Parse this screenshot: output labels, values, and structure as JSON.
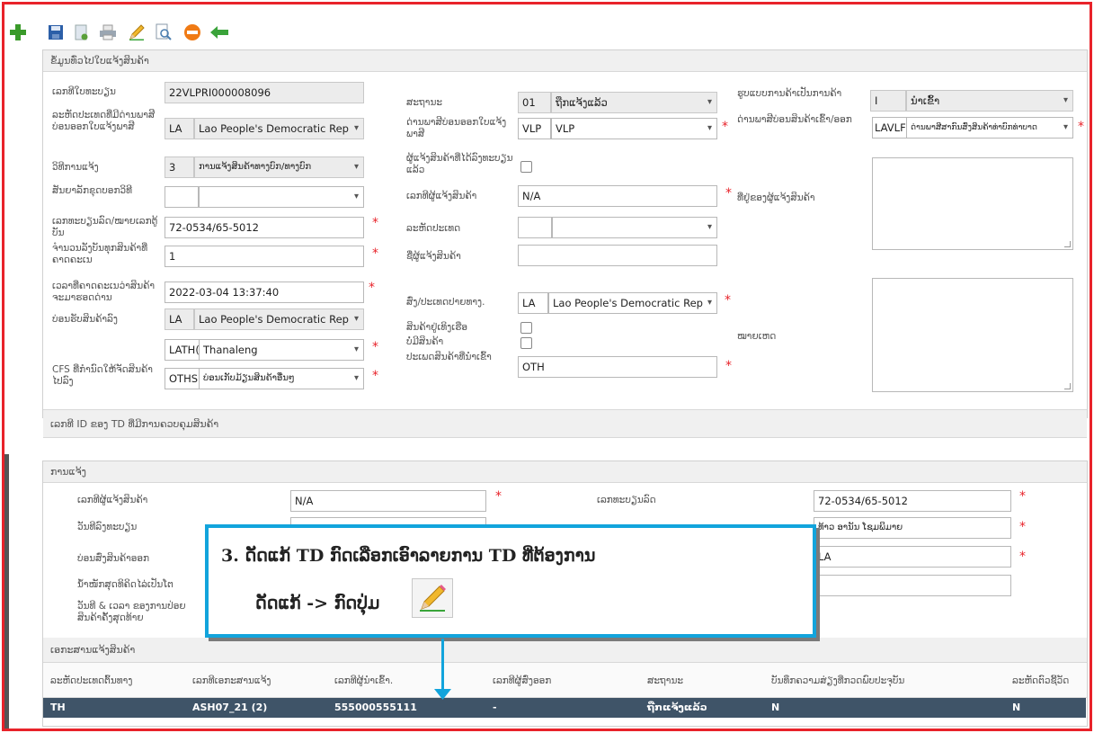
{
  "toolbar": {
    "icons": [
      "plus-icon",
      "save-icon",
      "new-doc-icon",
      "print-icon",
      "pencil-icon",
      "preview-icon",
      "delete-icon",
      "back-arrow-icon"
    ]
  },
  "section1": {
    "title": "ຂໍ້ມູນທົ່ວໄປໃບແຈ້ງສິນຄ້າ",
    "registration_number": {
      "label": "ເລກທີໃບທະບຽນ",
      "value": "22VLPRI000008096"
    },
    "country_code": {
      "label": "ລະຫັດປະເທດທີ່ມີດ່ານພາສີບ່ອນອອກໃບແຈ້ງພາສີ",
      "code": "LA",
      "name": "Lao People's Democratic Rep"
    },
    "transport_method": {
      "label": "ວິທີການແຈ້ງ",
      "code": "3",
      "name": "ການແຈ້ງສິນຄ້າທາງບົກ/ທາງບົກ"
    },
    "transport_detail": {
      "label": "ສັນຍາລັກຂຸດບອກວິທີ",
      "code": "",
      "name": ""
    },
    "vehicle_plate": {
      "label": "ເລກທະບຽນລົດ/ໝາຍເລກຕູ້ບັນ",
      "value": "72-0534/65-5012"
    },
    "packages_count": {
      "label": "ຈຳນວນລັງບັນທຸກສິນຄ້າທີ່ຄາດຄະເນ",
      "value": "1"
    },
    "arrival_datetime": {
      "label": "ເວລາທີ່ຄາດຄະເນວ່າສິນຄ້າຈະມາຮອດດ່ານ",
      "value": "2022-03-04 13:37:40"
    },
    "receive_country": {
      "label": "ບ່ອນຮັບສິນຄ້າລົງ",
      "code": "LA",
      "name": "Lao People's Democratic Rep"
    },
    "receive_office": {
      "code": "LATH(",
      "name": "Thanaleng"
    },
    "cfs_place": {
      "label": "CFS ທີ່ກຳນົດໃຫ້ຈັດສິນຄ້າໄປລົງ",
      "code": "OTHS",
      "name": "ບ່ອນເກັບມ້ຽນສິນຄ້າອື່ນໆ"
    },
    "status": {
      "label": "ສະຖານະ",
      "code": "01",
      "name": "ຖືກແຈ້ງແລ້ວ"
    },
    "customs_office": {
      "label": "ດ່ານພາສີບ່ອນອອກໃບແຈ້ງພາສີ",
      "code": "VLP",
      "name": "VLP"
    },
    "declarant_registered": {
      "label": "ຜູ້ແຈ້ງສິນຄ້າທີ່ໄດ້ລົງທະບຽນແລ້ວ"
    },
    "declarant_number": {
      "label": "ເລກທີຜູ້ແຈ້ງສິນຄ້າ",
      "value": "N/A"
    },
    "country_code2": {
      "label": "ລະຫັດປະເທດ",
      "code": "",
      "name": ""
    },
    "declarant_name": {
      "label": "ຊື່ຜູ້ແຈ້ງສິນຄ້າ",
      "value": ""
    },
    "destination_country": {
      "label": "ສົ່ງ/ປະເທດປາຍທາງ.",
      "code": "LA",
      "name": "Lao People's Democratic Rep"
    },
    "dangerous_goods": {
      "label": "ສິນຄ້າຢູ່ເທິງເຮືອ"
    },
    "no_goods": {
      "label": "ບໍ່ມີສິນຄ້າ"
    },
    "goods_type": {
      "label": "ປະເພດສິນຄ້າທີ່ນຳເຂົ້າ",
      "value": "OTH"
    },
    "goods_category": {
      "label": "ຮູບແບບການຄ້າເປັນການຄ້າ",
      "code": "I",
      "name": "ນຳເຂົ້າ"
    },
    "border_office": {
      "label": "ດ່ານພາສີບ່ອນສິນຄ້າເຂົ້າ/ອອກ",
      "code": "LAVLF",
      "name": "ດ່ານພາສີສາກົນສົ່ງສິນຄ້າທ່າບົກທ່າບາດ"
    },
    "declarant_address": {
      "label": "ທີ່ຢູ່ຂອງຜູ້ແຈ້ງສິນຄ້າ"
    },
    "remarks": {
      "label": "ໝາຍເຫດ"
    }
  },
  "section2": {
    "title": "ເລກທີ ID ຂອງ TD ທີ່ມີການຄວບຄຸມສິນຄ້າ"
  },
  "section3": {
    "title": "ການແຈ້ງ",
    "declarant_number": {
      "label": "ເລກທີຜູ້ແຈ້ງສິນຄ້າ",
      "value": "N/A"
    },
    "registration_date": {
      "label": "ວັນທີລົງທະບຽນ",
      "value": ""
    },
    "exit_place": {
      "label": "ບ່ອນສົ່ງສິນຄ້າອອກ",
      "value": ""
    },
    "cargo_weight": {
      "label": "ນ້ຳໜັກສຸດທິຄິດໄລ່ເປັນໂຕ",
      "value": ""
    },
    "last_date": {
      "label": "ວັນທີ & ເວລາ ຂອງການປ່ອຍສິນຄ້າຄັ້ງສຸດທ້າຍ",
      "value": ""
    },
    "plate_number": {
      "label": "ເລກທະບຽນລົດ",
      "value": "72-0534/65-5012"
    },
    "driver_name": {
      "label": "ຊື່ຄົນຂັບ",
      "value": "ທ້າວ ອານັນ ໂຊມພິມາຍ"
    },
    "country": {
      "label": "",
      "value": "LA"
    },
    "extra": {
      "value": ""
    }
  },
  "section4": {
    "title": "ເອກະສານແຈ້ງສິນຄ້າ",
    "columns": [
      "ລະຫັດປະເທດຕົ້ນທາງ",
      "ເລກທີເອກະສານແຈ້ງ",
      "ເລກທີຜູ້ນຳເຂົ້າ.",
      "ເລກທີຜູ້ສົ່ງອອກ",
      "ສະຖານະ",
      "ບັນທຶກຄວາມສ່ຽງທີ່ກວດພົບປະຈຸບັນ",
      "ລະຫັດຕົວຊີ້ວັດ"
    ],
    "rows": [
      [
        "TH",
        "ASH07_21 (2)",
        "555000555111",
        "-",
        "ຖືກແຈ້ງແລ້ວ",
        "N",
        "N"
      ]
    ]
  },
  "callout": {
    "line1": "3.   ດັດແກ້ TD ກົດເລືອກເອົາລາຍການ TD ທີ່ຕ້ອງການ",
    "line2": "ດັດແກ້ -> ກົດປຸ່ມ"
  },
  "colors": {
    "accent": "#12a4dc",
    "frame": "#e8232a",
    "row": "#3f5468",
    "required": "#e8232a"
  }
}
